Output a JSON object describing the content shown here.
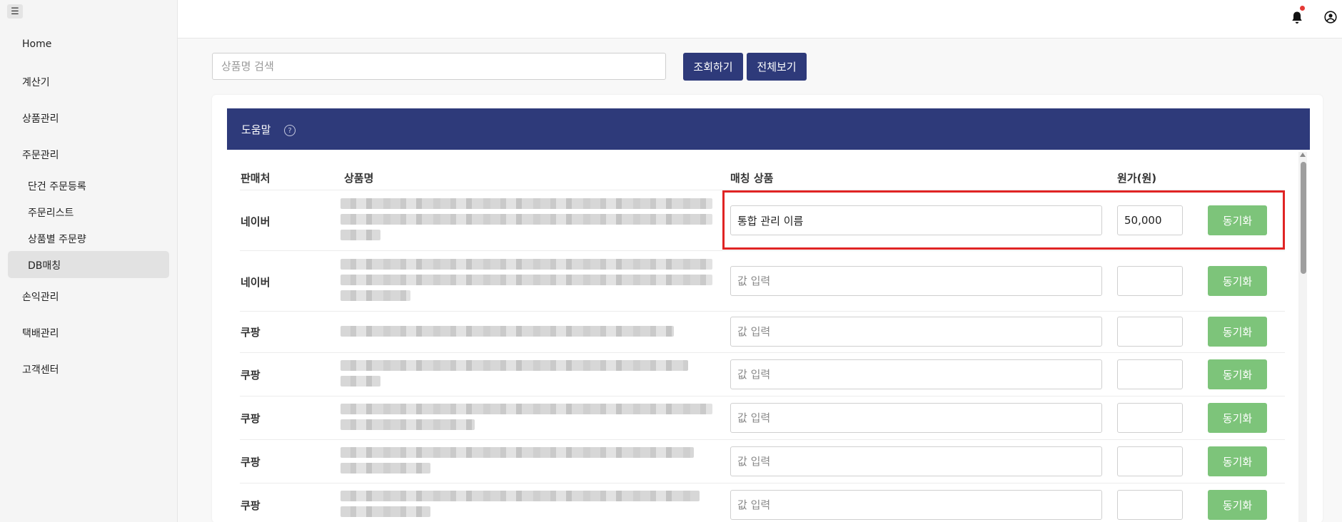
{
  "sidebar": {
    "menu_icon": "hamburger-icon",
    "menu_glyph": "☰",
    "items": [
      {
        "label": "Home"
      },
      {
        "label": "계산기"
      },
      {
        "label": "상품관리"
      },
      {
        "label": "주문관리"
      },
      {
        "label": "손익관리"
      },
      {
        "label": "택배관리"
      },
      {
        "label": "고객센터"
      }
    ],
    "sub_items": [
      {
        "label": "단건 주문등록"
      },
      {
        "label": "주문리스트"
      },
      {
        "label": "상품별 주문량"
      },
      {
        "label": "DB매칭",
        "active": true
      }
    ]
  },
  "topbar": {
    "notification_icon": "bell-icon",
    "user_icon": "user-circle-icon",
    "has_unread": true
  },
  "search": {
    "placeholder": "상품명 검색",
    "value": "",
    "search_label": "조회하기",
    "all_label": "전체보기"
  },
  "help_bar": {
    "label": "도움말",
    "help_glyph": "?",
    "icon": "question-circle-icon"
  },
  "table": {
    "headers": {
      "seller": "판매처",
      "product": "상품명",
      "match": "매칭 상품",
      "cost": "원가(원)"
    },
    "match_placeholder": "값 입력",
    "sync_label": "동기화",
    "rows": [
      {
        "seller": "네이버",
        "match_value": "통합 관리 이름",
        "cost": "50,000",
        "highlighted": true
      },
      {
        "seller": "네이버",
        "match_value": "",
        "cost": ""
      },
      {
        "seller": "쿠팡",
        "match_value": "",
        "cost": ""
      },
      {
        "seller": "쿠팡",
        "match_value": "",
        "cost": ""
      },
      {
        "seller": "쿠팡",
        "match_value": "",
        "cost": ""
      },
      {
        "seller": "쿠팡",
        "match_value": "",
        "cost": ""
      },
      {
        "seller": "쿠팡",
        "match_value": "",
        "cost": ""
      }
    ]
  },
  "colors": {
    "primary": "#2e3a7a",
    "sync": "#7dc47a",
    "highlight": "#e02424"
  }
}
